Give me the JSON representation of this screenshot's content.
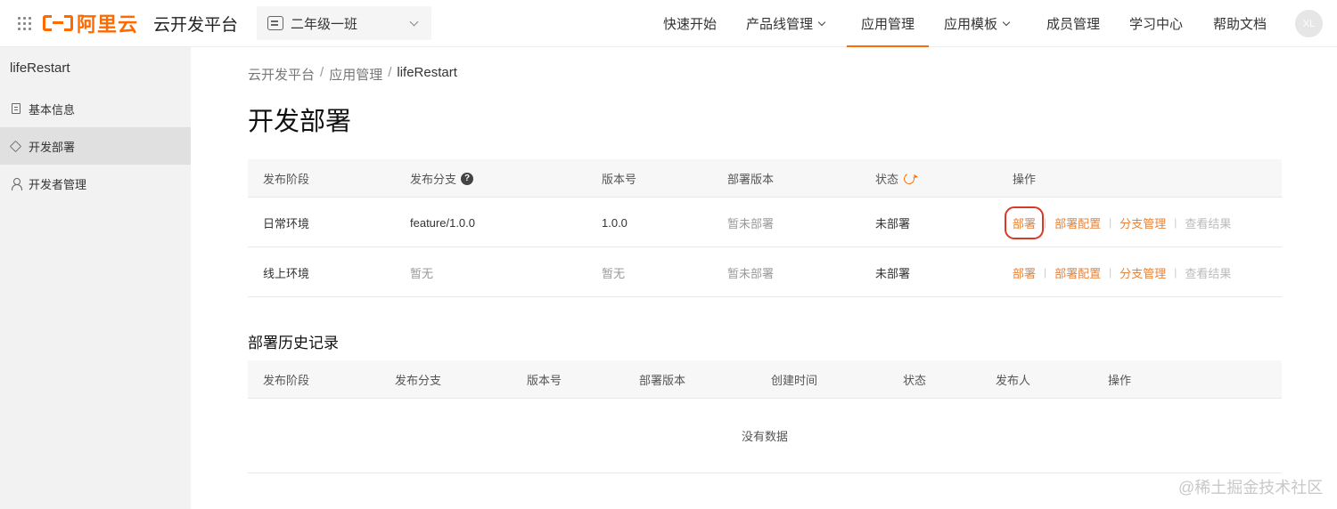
{
  "header": {
    "logo_text": "阿里云",
    "platform_title": "云开发平台",
    "project_select": "二年级一班",
    "nav": [
      {
        "label": "快速开始",
        "has_dropdown": false,
        "active": false
      },
      {
        "label": "产品线管理",
        "has_dropdown": true,
        "active": false
      },
      {
        "label": "应用管理",
        "has_dropdown": false,
        "active": true
      },
      {
        "label": "应用模板",
        "has_dropdown": true,
        "active": false
      },
      {
        "label": "成员管理",
        "has_dropdown": false,
        "active": false
      },
      {
        "label": "学习中心",
        "has_dropdown": false,
        "active": false
      },
      {
        "label": "帮助文档",
        "has_dropdown": false,
        "active": false
      }
    ],
    "avatar": "XL"
  },
  "sidebar": {
    "app_name": "lifeRestart",
    "items": [
      {
        "label": "基本信息",
        "icon": "document-icon",
        "active": false
      },
      {
        "label": "开发部署",
        "icon": "cube-icon",
        "active": true
      },
      {
        "label": "开发者管理",
        "icon": "user-icon",
        "active": false
      }
    ]
  },
  "breadcrumb": [
    "云开发平台",
    "应用管理",
    "lifeRestart"
  ],
  "page_title": "开发部署",
  "deploy_table": {
    "headers": [
      "发布阶段",
      "发布分支",
      "版本号",
      "部署版本",
      "状态",
      "操作"
    ],
    "rows": [
      {
        "stage": "日常环境",
        "branch": "feature/1.0.0",
        "version": "1.0.0",
        "deploy_version": "暂未部署",
        "status": "未部署"
      },
      {
        "stage": "线上环境",
        "branch": "暂无",
        "version": "暂无",
        "deploy_version": "暂未部署",
        "status": "未部署"
      }
    ],
    "actions": {
      "deploy": "部署",
      "deploy_config": "部署配置",
      "branch_manage": "分支管理",
      "view_result": "查看结果"
    }
  },
  "history": {
    "title": "部署历史记录",
    "headers": [
      "发布阶段",
      "发布分支",
      "版本号",
      "部署版本",
      "创建时间",
      "状态",
      "发布人",
      "操作"
    ],
    "empty_text": "没有数据"
  },
  "watermark": "@稀土掘金技术社区",
  "colors": {
    "accent": "#ff6a00",
    "action": "#e8833a",
    "highlight": "#d93a26"
  }
}
